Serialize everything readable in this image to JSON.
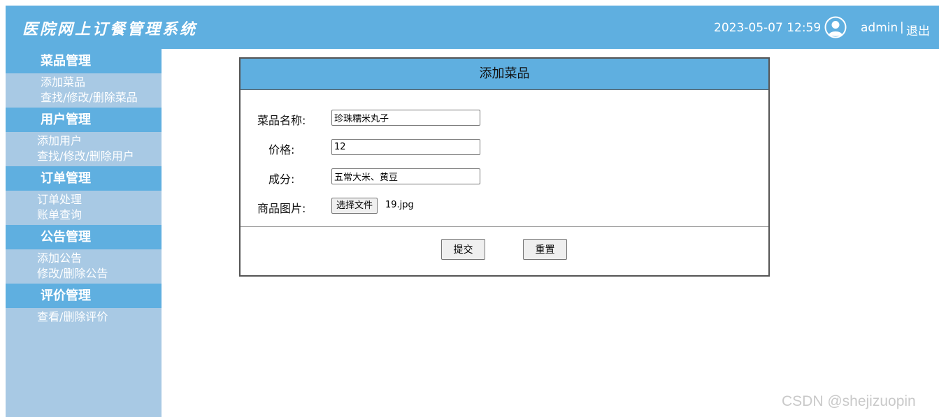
{
  "header": {
    "title": "医院网上订餐管理系统",
    "datetime": "2023-05-07 12:59",
    "user_icon": "user-circle-icon",
    "username": "admin",
    "separator": "|",
    "logout": "退出"
  },
  "sidebar": {
    "groups": [
      {
        "title": "菜品管理",
        "items": [
          "添加菜品",
          "查找/修改/删除菜品"
        ]
      },
      {
        "title": "用户管理",
        "items": [
          "添加用户",
          "查找/修改/删除用户"
        ]
      },
      {
        "title": "订单管理",
        "items": [
          "订单处理",
          "账单查询"
        ]
      },
      {
        "title": "公告管理",
        "items": [
          "添加公告",
          "修改/删除公告"
        ]
      },
      {
        "title": "评价管理",
        "items": [
          "查看/删除评价"
        ]
      }
    ]
  },
  "form": {
    "title": "添加菜品",
    "name_label": "菜品名称:",
    "name_value": "珍珠糯米丸子",
    "price_label": "价格:",
    "price_value": "12",
    "ingredients_label": "成分:",
    "ingredients_value": "五常大米、黄豆",
    "image_label": "商品图片:",
    "file_button": "选择文件",
    "file_name": "19.jpg",
    "submit": "提交",
    "reset": "重置"
  },
  "watermark": "CSDN @shejizuopin",
  "colors": {
    "header_bg": "#5fafe0",
    "sidebar_bg": "#a8c9e4",
    "text_on_blue": "#ffffff"
  }
}
